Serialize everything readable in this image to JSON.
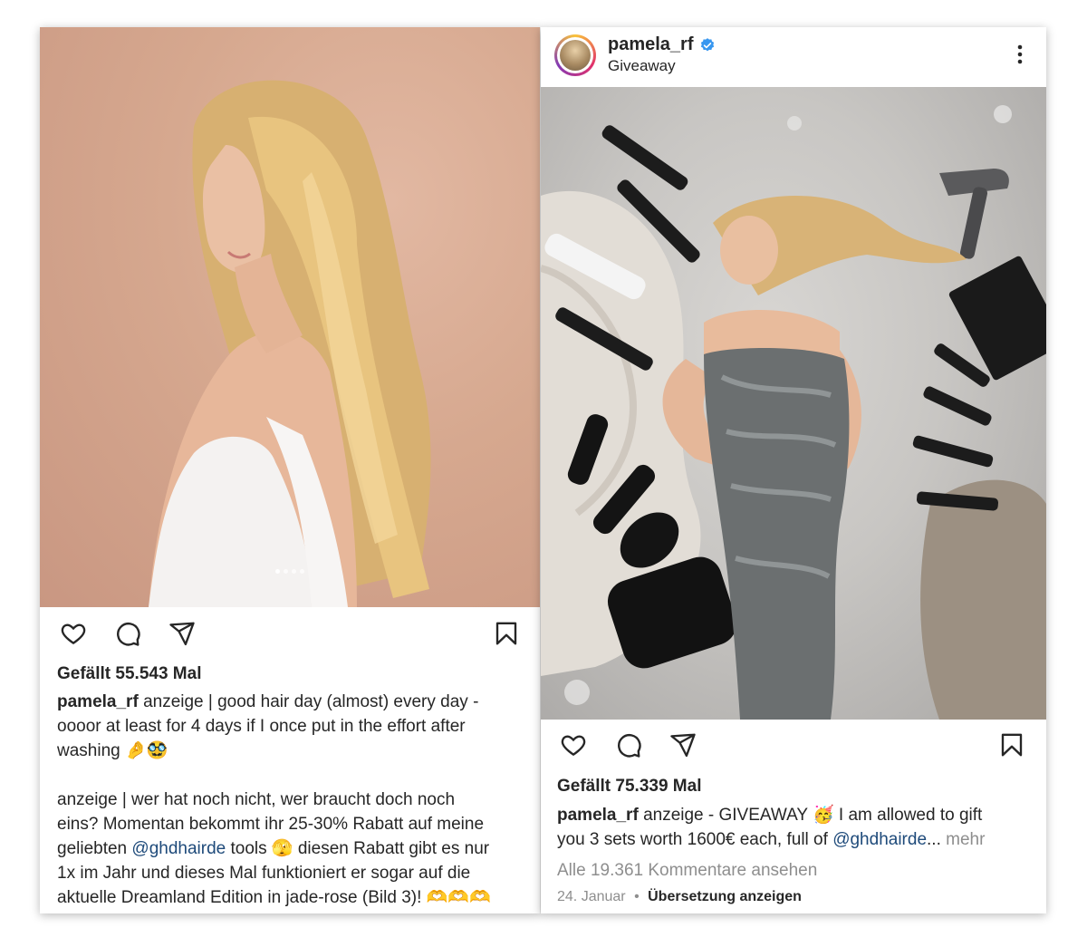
{
  "left_post": {
    "carousel_total": 4,
    "carousel_active": 1,
    "likes": "Gefällt 55.543 Mal",
    "caption": {
      "username": "pamela_rf",
      "text_1": "anzeige | good hair day (almost) every day -",
      "text_2": "oooor at least for 4 days if I once put in the effort after",
      "text_3": "washing 🤌🥸",
      "text_4": "anzeige | wer hat noch nicht, wer braucht doch noch",
      "text_5": "eins? Momentan bekommt ihr 25-30% Rabatt auf meine",
      "text_6_pre": "geliebten",
      "text_6_mention": "@ghdhairde",
      "text_6_post": "tools 🫣 diesen Rabatt gibt es nur",
      "text_7": "1x im Jahr und dieses Mal funktioniert er sogar auf die",
      "text_8": "aktuelle Dreamland Edition in jade-rose (Bild 3)! 🫶🫶🫶"
    }
  },
  "right_post": {
    "header": {
      "username": "pamela_rf",
      "subtitle": "Giveaway"
    },
    "likes": "Gefällt 75.339 Mal",
    "caption": {
      "username": "pamela_rf",
      "text_1": "anzeige - GIVEAWAY 🥳 I am allowed to gift",
      "text_2_pre": "you 3 sets worth 1600€ each, full of",
      "text_2_mention": "@ghdhairde",
      "text_2_ellipsis": "...",
      "more_label": "mehr"
    },
    "view_comments": "Alle 19.361 Kommentare ansehen",
    "date": "24. Januar",
    "separator": "•",
    "translate": "Übersetzung anzeigen"
  },
  "colors": {
    "text": "#262626",
    "muted": "#8e8e8e",
    "mention": "#1e4a7a",
    "verified": "#3897f0"
  },
  "icons": [
    "heart-icon",
    "comment-icon",
    "share-icon",
    "bookmark-icon",
    "verified-icon",
    "more-options-icon"
  ]
}
